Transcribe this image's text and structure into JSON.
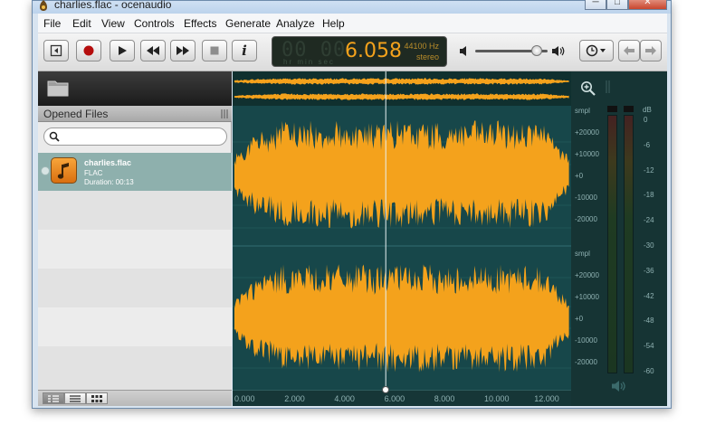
{
  "window": {
    "title": "charlies.flac - ocenaudio",
    "controls": {
      "minimize": "─",
      "maximize": "□",
      "close": "✕"
    }
  },
  "menu": [
    "File",
    "Edit",
    "View",
    "Controls",
    "Effects",
    "Generate",
    "Analyze",
    "Help"
  ],
  "toolbar": {
    "buttons": [
      "back-to-start",
      "record",
      "play",
      "rewind",
      "fast-forward",
      "stop",
      "info"
    ],
    "time_display": {
      "ghost_digits": "00 00",
      "time": "6.058",
      "sample_rate": "44100 Hz",
      "channels": "stereo",
      "units": "hr  min sec"
    },
    "volume_level": 0.85
  },
  "sidebar": {
    "header": "Opened Files",
    "search": {
      "value": "",
      "placeholder": ""
    },
    "files": [
      {
        "name": "charlies.flac",
        "format": "FLAC",
        "duration": "Duration: 00:13"
      }
    ]
  },
  "waveform": {
    "cursor_time_sec": 6.058,
    "timeline": [
      "0.000",
      "2.000",
      "4.000",
      "6.000",
      "8.000",
      "10.000",
      "12.000"
    ],
    "channel_scale": [
      "smpl",
      "+20000",
      "+10000",
      "+0",
      "-10000",
      "-20000"
    ],
    "colors": {
      "wave": "#f4a21c",
      "background": "#17474a"
    }
  },
  "meter": {
    "unit": "dB",
    "labels": [
      "0",
      "-6",
      "-12",
      "-18",
      "-24",
      "-30",
      "-36",
      "-42",
      "-48",
      "-54",
      "-60"
    ]
  }
}
